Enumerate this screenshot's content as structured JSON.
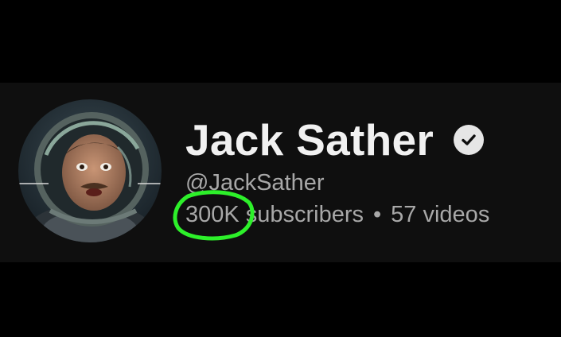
{
  "channel": {
    "name": "Jack Sather",
    "handle": "@JackSather",
    "subscriber_count": "300K",
    "subscribers_label": "subscribers",
    "separator": "•",
    "video_count_text": "57 videos",
    "verified": true
  },
  "icons": {
    "avatar": "astronaut-avatar",
    "verified": "verified-check-icon"
  },
  "colors": {
    "background": "#000000",
    "band": "#0f0f0f",
    "primary_text": "#f1f1f1",
    "secondary_text": "#a8a8a8",
    "highlight": "#2df02a"
  }
}
